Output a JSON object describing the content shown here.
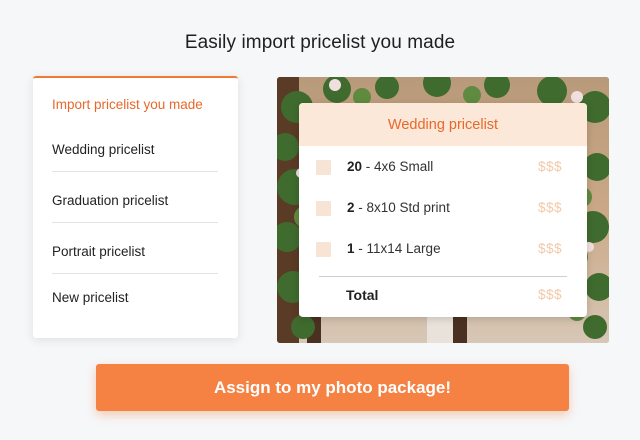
{
  "heading": "Easily import pricelist you made",
  "pricelists": [
    {
      "label": "Import pricelist you made",
      "active": true
    },
    {
      "label": "Wedding pricelist"
    },
    {
      "label": "Graduation pricelist"
    },
    {
      "label": "Portrait pricelist"
    },
    {
      "label": "New pricelist"
    }
  ],
  "price_card": {
    "title": "Wedding pricelist",
    "rows": [
      {
        "qty": "20",
        "desc": " - 4x6 Small",
        "price": "$$$"
      },
      {
        "qty": "2",
        "desc": " - 8x10 Std print",
        "price": "$$$"
      },
      {
        "qty": "1",
        "desc": " - 11x14 Large",
        "price": "$$$"
      }
    ],
    "total_label": "Total",
    "total_price": "$$$"
  },
  "cta_label": "Assign to my photo package!",
  "colors": {
    "accent": "#f58142",
    "accent_text": "#e8682a",
    "card_header_bg": "#fbe8d9",
    "price_text": "#f3c9a6"
  }
}
